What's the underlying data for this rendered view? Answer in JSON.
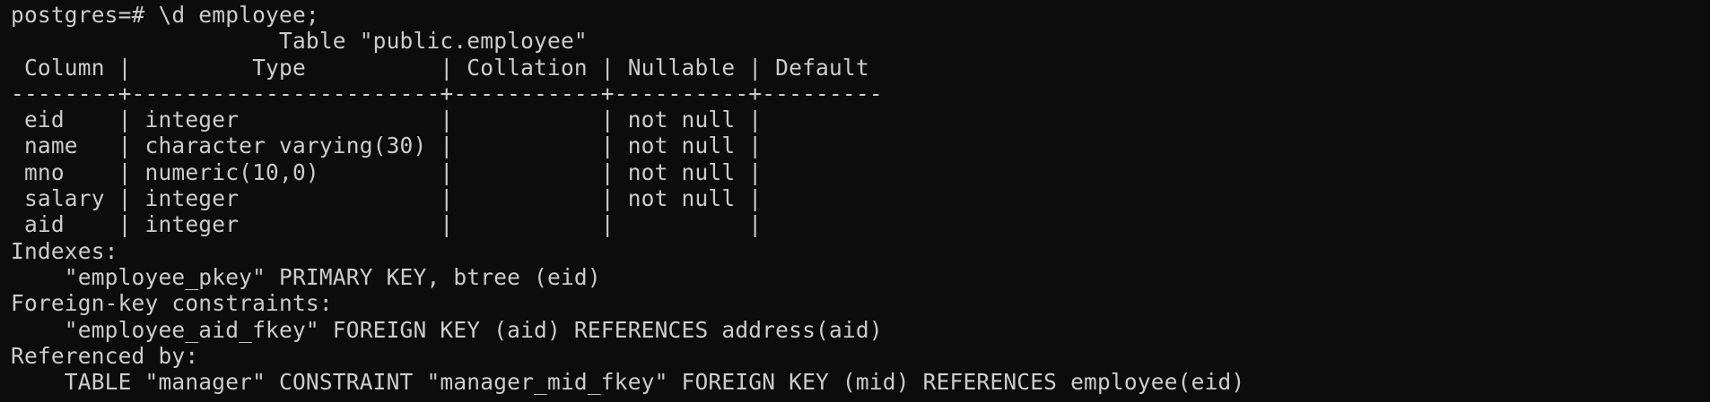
{
  "terminal": {
    "lines": [
      "postgres=# \\d employee;",
      "                    Table \"public.employee\"",
      " Column |         Type          | Collation | Nullable | Default",
      "--------+-----------------------+-----------+----------+---------",
      " eid    | integer               |           | not null |",
      " name   | character varying(30) |           | not null |",
      " mno    | numeric(10,0)         |           | not null |",
      " salary | integer               |           | not null |",
      " aid    | integer               |           |          |",
      "Indexes:",
      "    \"employee_pkey\" PRIMARY KEY, btree (eid)",
      "Foreign-key constraints:",
      "    \"employee_aid_fkey\" FOREIGN KEY (aid) REFERENCES address(aid)",
      "Referenced by:",
      "    TABLE \"manager\" CONSTRAINT \"manager_mid_fkey\" FOREIGN KEY (mid) REFERENCES employee(eid)"
    ]
  },
  "colors": {
    "background": "#0c0c0c",
    "foreground": "#cccccc"
  }
}
